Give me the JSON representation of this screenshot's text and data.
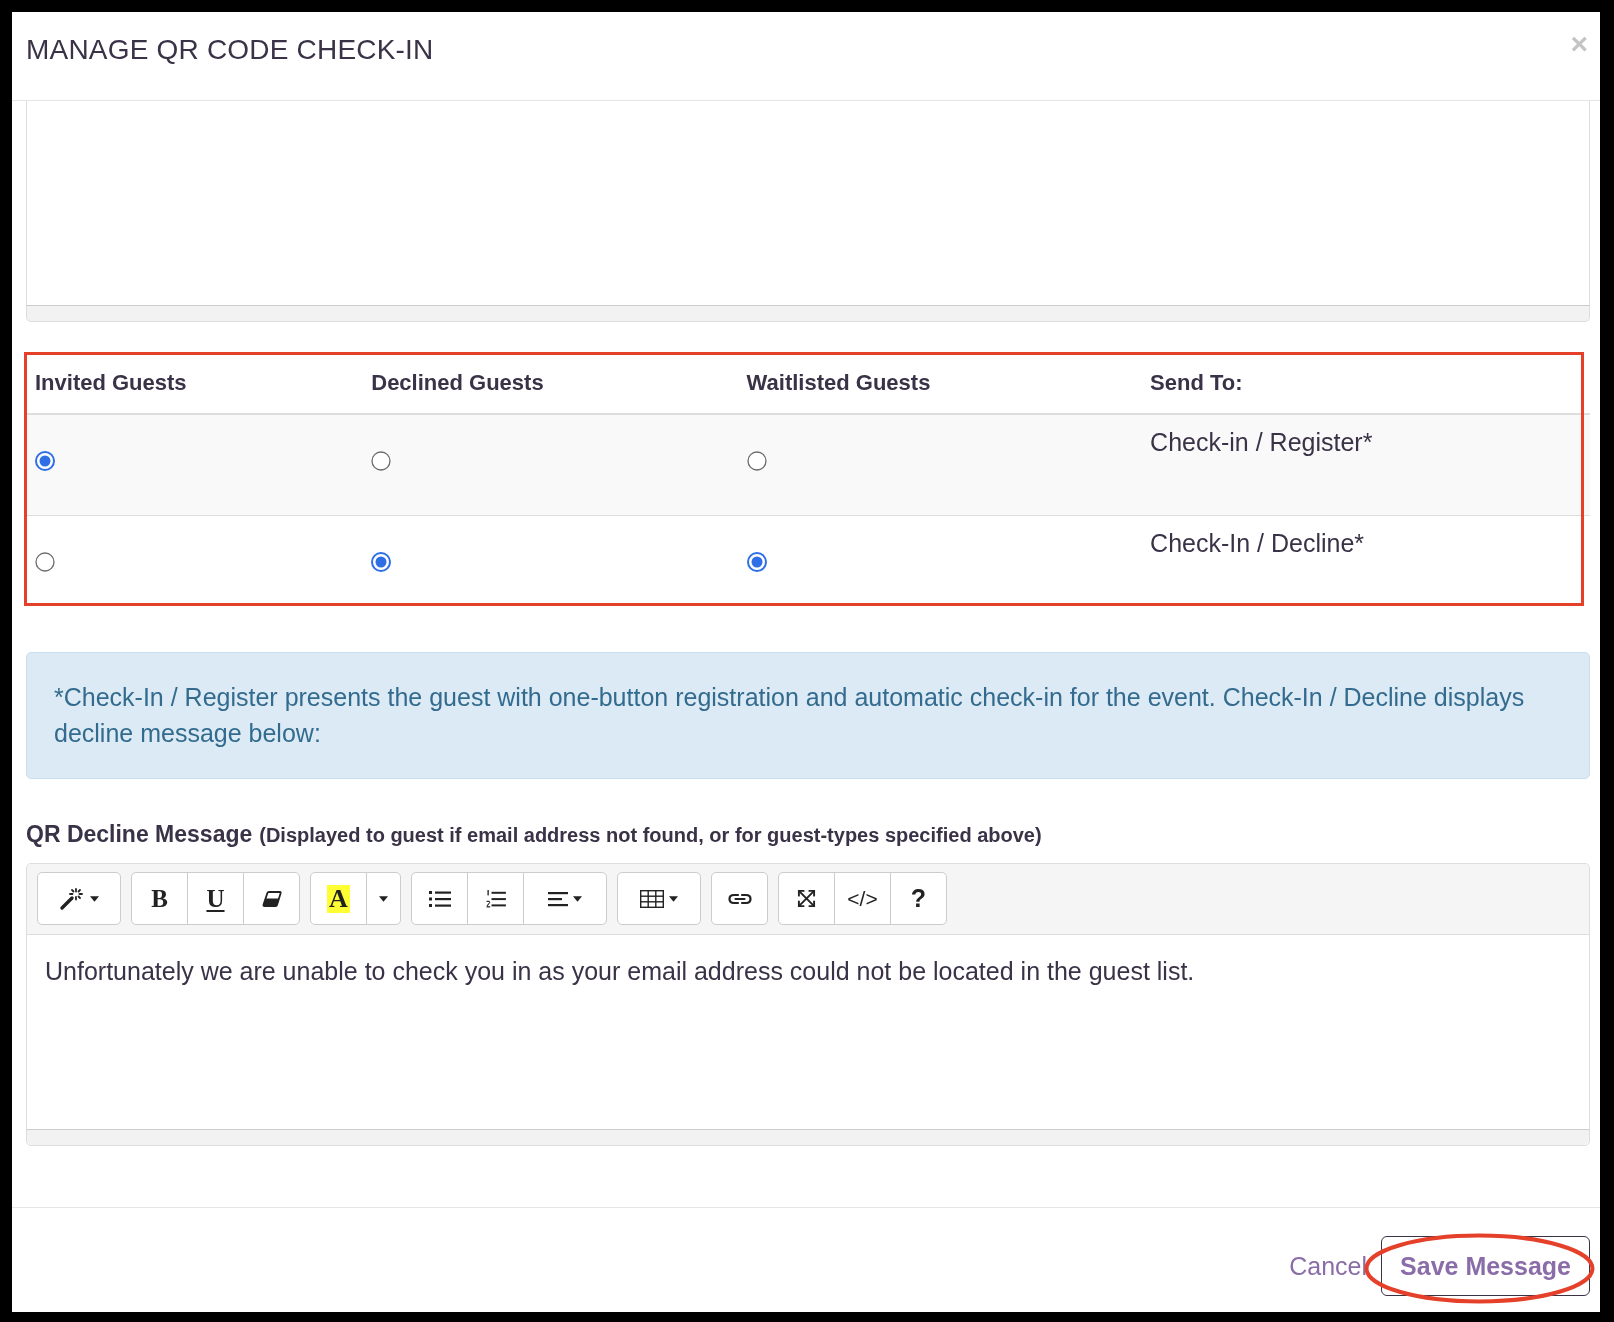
{
  "dialog": {
    "title": "MANAGE QR CODE CHECK-IN",
    "close": "×"
  },
  "guest_table": {
    "highlighted": true,
    "columns": [
      "Invited Guests",
      "Declined Guests",
      "Waitlisted Guests",
      "Send To:"
    ],
    "rows": [
      {
        "choices": [
          {
            "selected": true
          },
          {
            "selected": false
          },
          {
            "selected": false
          }
        ],
        "send_to": "Check-in / Register*"
      },
      {
        "choices": [
          {
            "selected": false
          },
          {
            "selected": true
          },
          {
            "selected": true
          }
        ],
        "send_to": "Check-In / Decline*"
      }
    ]
  },
  "info_note": "*Check-In / Register presents the guest with one-button registration and automatic check-in for the event. Check-In / Decline displays decline message below:",
  "decline_message": {
    "label": "QR Decline Message",
    "hint": "(Displayed to guest if email address not found, or for guest-types specified above)",
    "toolbar": [
      [
        {
          "kind": "style"
        }
      ],
      [
        {
          "kind": "bold",
          "label": "B"
        },
        {
          "kind": "underline",
          "label": "U"
        },
        {
          "kind": "eraser"
        }
      ],
      [
        {
          "kind": "highlight",
          "label": "A"
        },
        {
          "kind": "dropdown"
        }
      ],
      [
        {
          "kind": "bullet-list"
        },
        {
          "kind": "numbered-list"
        },
        {
          "kind": "align"
        }
      ],
      [
        {
          "kind": "table"
        }
      ],
      [
        {
          "kind": "link"
        }
      ],
      [
        {
          "kind": "fullscreen"
        },
        {
          "kind": "code",
          "label": "</>"
        },
        {
          "kind": "help",
          "label": "?"
        }
      ]
    ],
    "value": "Unfortunately we are unable to check you in as your email address could not be located in the guest list."
  },
  "footer": {
    "cancel": "Cancel",
    "save_button": {
      "label": "Save Message",
      "highlighted": true
    }
  }
}
